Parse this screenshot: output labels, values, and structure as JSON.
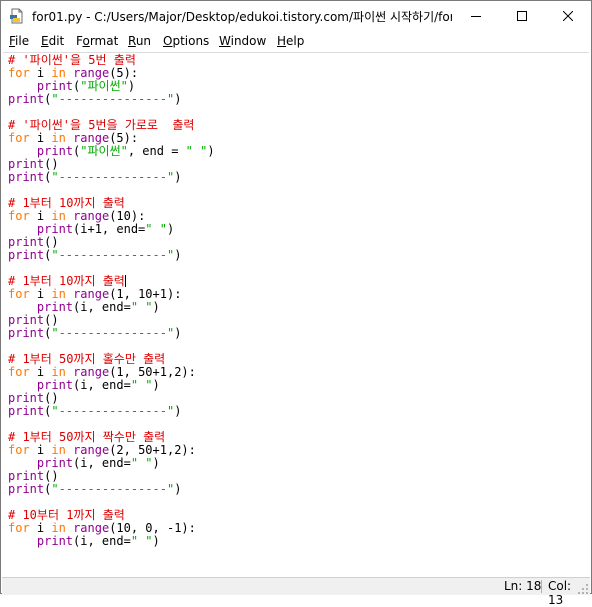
{
  "window": {
    "title": "for01.py - C:/Users/Major/Desktop/edukoi.tistory.com/파이썬 시작하기/for0...",
    "icon": "python-file-icon"
  },
  "menu": [
    {
      "label": "File",
      "mnemonic": "F",
      "rest": "ile"
    },
    {
      "label": "Edit",
      "mnemonic": "E",
      "rest": "dit"
    },
    {
      "label": "Format",
      "mnemonic": "o",
      "pre": "F",
      "rest": "rmat"
    },
    {
      "label": "Run",
      "mnemonic": "R",
      "rest": "un"
    },
    {
      "label": "Options",
      "mnemonic": "O",
      "rest": "ptions"
    },
    {
      "label": "Window",
      "mnemonic": "W",
      "rest": "indow"
    },
    {
      "label": "Help",
      "mnemonic": "H",
      "rest": "elp"
    }
  ],
  "code_lines": [
    [
      [
        "c-comment",
        "# '파이썬'을 5번 출력"
      ]
    ],
    [
      [
        "c-kw",
        "for"
      ],
      [
        "c-plain",
        " i "
      ],
      [
        "c-kw",
        "in"
      ],
      [
        "c-plain",
        " "
      ],
      [
        "c-builtin",
        "range"
      ],
      [
        "c-plain",
        "(5):"
      ]
    ],
    [
      [
        "c-plain",
        "    "
      ],
      [
        "c-builtin",
        "print"
      ],
      [
        "c-plain",
        "("
      ],
      [
        "c-string",
        "\"파이썬\""
      ],
      [
        "c-plain",
        ")"
      ]
    ],
    [
      [
        "c-builtin",
        "print"
      ],
      [
        "c-plain",
        "("
      ],
      [
        "c-string",
        "\"---------------\""
      ],
      [
        "c-plain",
        ")"
      ]
    ],
    [],
    [
      [
        "c-comment",
        "# '파이썬'을 5번을 가로로  출력"
      ]
    ],
    [
      [
        "c-kw",
        "for"
      ],
      [
        "c-plain",
        " i "
      ],
      [
        "c-kw",
        "in"
      ],
      [
        "c-plain",
        " "
      ],
      [
        "c-builtin",
        "range"
      ],
      [
        "c-plain",
        "(5):"
      ]
    ],
    [
      [
        "c-plain",
        "    "
      ],
      [
        "c-builtin",
        "print"
      ],
      [
        "c-plain",
        "("
      ],
      [
        "c-string",
        "\"파이썬\""
      ],
      [
        "c-plain",
        ", end = "
      ],
      [
        "c-string",
        "\" \""
      ],
      [
        "c-plain",
        ")"
      ]
    ],
    [
      [
        "c-builtin",
        "print"
      ],
      [
        "c-plain",
        "()"
      ]
    ],
    [
      [
        "c-builtin",
        "print"
      ],
      [
        "c-plain",
        "("
      ],
      [
        "c-string",
        "\"---------------\""
      ],
      [
        "c-plain",
        ")"
      ]
    ],
    [],
    [
      [
        "c-comment",
        "# 1부터 10까지 출력"
      ]
    ],
    [
      [
        "c-kw",
        "for"
      ],
      [
        "c-plain",
        " i "
      ],
      [
        "c-kw",
        "in"
      ],
      [
        "c-plain",
        " "
      ],
      [
        "c-builtin",
        "range"
      ],
      [
        "c-plain",
        "(10):"
      ]
    ],
    [
      [
        "c-plain",
        "    "
      ],
      [
        "c-builtin",
        "print"
      ],
      [
        "c-plain",
        "(i+1, end="
      ],
      [
        "c-string",
        "\" \""
      ],
      [
        "c-plain",
        ")"
      ]
    ],
    [
      [
        "c-builtin",
        "print"
      ],
      [
        "c-plain",
        "()"
      ]
    ],
    [
      [
        "c-builtin",
        "print"
      ],
      [
        "c-plain",
        "("
      ],
      [
        "c-string",
        "\"---------------\""
      ],
      [
        "c-plain",
        ")"
      ]
    ],
    [],
    [
      [
        "c-comment",
        "# 1부터 10까지 출력"
      ],
      [
        "caret",
        ""
      ]
    ],
    [
      [
        "c-kw",
        "for"
      ],
      [
        "c-plain",
        " i "
      ],
      [
        "c-kw",
        "in"
      ],
      [
        "c-plain",
        " "
      ],
      [
        "c-builtin",
        "range"
      ],
      [
        "c-plain",
        "(1, 10+1):"
      ]
    ],
    [
      [
        "c-plain",
        "    "
      ],
      [
        "c-builtin",
        "print"
      ],
      [
        "c-plain",
        "(i, end="
      ],
      [
        "c-string",
        "\" \""
      ],
      [
        "c-plain",
        ")"
      ]
    ],
    [
      [
        "c-builtin",
        "print"
      ],
      [
        "c-plain",
        "()"
      ]
    ],
    [
      [
        "c-builtin",
        "print"
      ],
      [
        "c-plain",
        "("
      ],
      [
        "c-string",
        "\"---------------\""
      ],
      [
        "c-plain",
        ")"
      ]
    ],
    [],
    [
      [
        "c-comment",
        "# 1부터 50까지 홀수만 출력"
      ]
    ],
    [
      [
        "c-kw",
        "for"
      ],
      [
        "c-plain",
        " i "
      ],
      [
        "c-kw",
        "in"
      ],
      [
        "c-plain",
        " "
      ],
      [
        "c-builtin",
        "range"
      ],
      [
        "c-plain",
        "(1, 50+1,2):"
      ]
    ],
    [
      [
        "c-plain",
        "    "
      ],
      [
        "c-builtin",
        "print"
      ],
      [
        "c-plain",
        "(i, end="
      ],
      [
        "c-string",
        "\" \""
      ],
      [
        "c-plain",
        ")"
      ]
    ],
    [
      [
        "c-builtin",
        "print"
      ],
      [
        "c-plain",
        "()"
      ]
    ],
    [
      [
        "c-builtin",
        "print"
      ],
      [
        "c-plain",
        "("
      ],
      [
        "c-string",
        "\"---------------\""
      ],
      [
        "c-plain",
        ")"
      ]
    ],
    [],
    [
      [
        "c-comment",
        "# 1부터 50까지 짝수만 출력"
      ]
    ],
    [
      [
        "c-kw",
        "for"
      ],
      [
        "c-plain",
        " i "
      ],
      [
        "c-kw",
        "in"
      ],
      [
        "c-plain",
        " "
      ],
      [
        "c-builtin",
        "range"
      ],
      [
        "c-plain",
        "(2, 50+1,2):"
      ]
    ],
    [
      [
        "c-plain",
        "    "
      ],
      [
        "c-builtin",
        "print"
      ],
      [
        "c-plain",
        "(i, end="
      ],
      [
        "c-string",
        "\" \""
      ],
      [
        "c-plain",
        ")"
      ]
    ],
    [
      [
        "c-builtin",
        "print"
      ],
      [
        "c-plain",
        "()"
      ]
    ],
    [
      [
        "c-builtin",
        "print"
      ],
      [
        "c-plain",
        "("
      ],
      [
        "c-string",
        "\"---------------\""
      ],
      [
        "c-plain",
        ")"
      ]
    ],
    [],
    [
      [
        "c-comment",
        "# 10부터 1까지 출력"
      ]
    ],
    [
      [
        "c-kw",
        "for"
      ],
      [
        "c-plain",
        " i "
      ],
      [
        "c-kw",
        "in"
      ],
      [
        "c-plain",
        " "
      ],
      [
        "c-builtin",
        "range"
      ],
      [
        "c-plain",
        "(10, 0, -1):"
      ]
    ],
    [
      [
        "c-plain",
        "    "
      ],
      [
        "c-builtin",
        "print"
      ],
      [
        "c-plain",
        "(i, end="
      ],
      [
        "c-string",
        "\" \""
      ],
      [
        "c-plain",
        ")"
      ]
    ]
  ],
  "status": {
    "line": "Ln: 18",
    "col": "Col: 13"
  }
}
